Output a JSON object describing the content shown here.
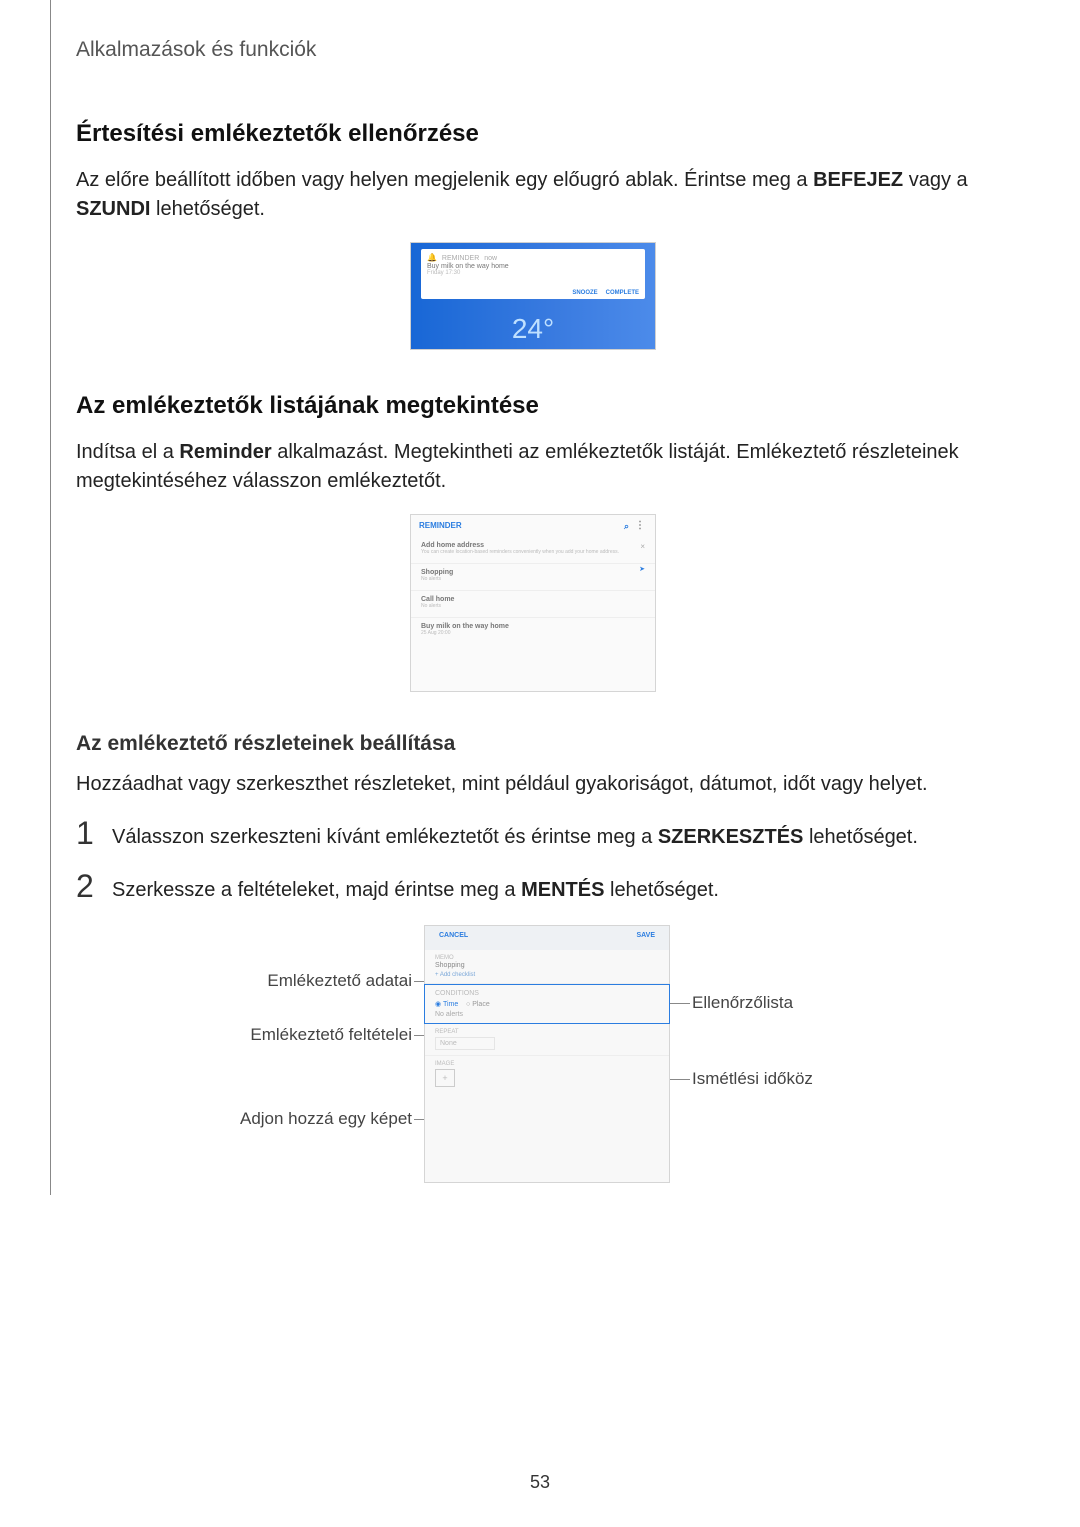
{
  "breadcrumb": "Alkalmazások és funkciók",
  "section1": {
    "title": "Értesítési emlékeztetők ellenőrzése",
    "para_before": "Az előre beállított időben vagy helyen megjelenik egy előugró ablak. Érintse meg a ",
    "bold1": "BEFEJEZ",
    "mid": " vagy a ",
    "bold2": "SZUNDI",
    "after": " lehetőséget."
  },
  "fig1": {
    "notif_app": "REMINDER",
    "notif_sub": "now",
    "line": "Buy milk on the way home",
    "time": "Friday 17:30",
    "btn_snooze": "SNOOZE",
    "btn_complete": "COMPLETE",
    "big_num": "24°"
  },
  "section2": {
    "title": "Az emlékeztetők listájának megtekintése",
    "para_a": "Indítsa el a ",
    "bold_app": "Reminder",
    "para_b": " alkalmazást. Megtekintheti az emlékeztetők listáját. Emlékeztető részleteinek megtekintéséhez válasszon emlékeztetőt."
  },
  "fig2": {
    "header": "REMINDER",
    "row1_t": "Add home address",
    "row1_s": "You can create location-based reminders conveniently when you add your home address.",
    "row2_t": "Shopping",
    "row2_s": "No alerts",
    "row3_t": "Call home",
    "row3_s": "No alerts",
    "row4_t": "Buy milk on the way home",
    "row4_s": "25 Aug 20:00"
  },
  "sub_title": "Az emlékeztető részleteinek beállítása",
  "sub_para": "Hozzáadhat vagy szerkeszthet részleteket, mint például gyakoriságot, dátumot, időt vagy helyet.",
  "step1": {
    "num": "1",
    "a": "Válasszon szerkeszteni kívánt emlékeztetőt és érintse meg a ",
    "bold": "SZERKESZTÉS",
    "b": " lehetőséget."
  },
  "step2": {
    "num": "2",
    "a": "Szerkessze a feltételeket, majd érintse meg a ",
    "bold": "MENTÉS",
    "b": " lehetőséget."
  },
  "fig3": {
    "cancel": "CANCEL",
    "save": "SAVE",
    "memo_lbl": "MEMO",
    "memo_val": "Shopping",
    "checklist_hint": "+ Add checklist",
    "cond_lbl": "CONDITIONS",
    "radio_time": "Time",
    "radio_place": "Place",
    "noalerts": "No alerts",
    "repeat_lbl": "REPEAT",
    "repeat_val": "None",
    "image_lbl": "IMAGE"
  },
  "annotations": {
    "data": "Emlékeztető adatai",
    "conditions": "Emlékeztető feltételei",
    "addimage": "Adjon hozzá egy képet",
    "checklist": "Ellenőrzőlista",
    "repeat": "Ismétlési időköz"
  },
  "page_number": "53"
}
